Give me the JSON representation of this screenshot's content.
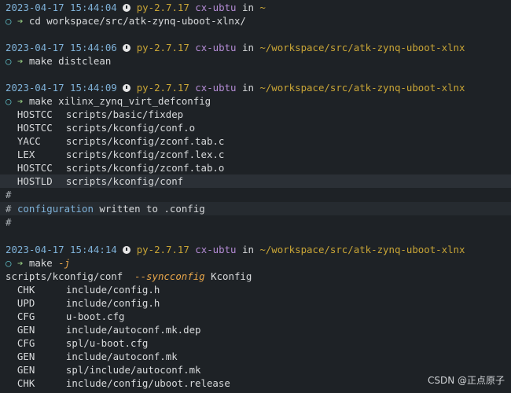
{
  "prompts": [
    {
      "date": "2023-04-17 15:44:04",
      "py": "py-2.7.17",
      "host": "cx-ubtu",
      "in": "in",
      "path": "~",
      "cmd": "cd workspace/src/atk-zynq-uboot-xlnx/"
    },
    {
      "date": "2023-04-17 15:44:06",
      "py": "py-2.7.17",
      "host": "cx-ubtu",
      "in": "in",
      "path": "~/workspace/src/atk-zynq-uboot-xlnx",
      "cmd": "make distclean"
    },
    {
      "date": "2023-04-17 15:44:09",
      "py": "py-2.7.17",
      "host": "cx-ubtu",
      "in": "in",
      "path": "~/workspace/src/atk-zynq-uboot-xlnx",
      "cmd": "make xilinx_zynq_virt_defconfig"
    },
    {
      "date": "2023-04-17 15:44:14",
      "py": "py-2.7.17",
      "host": "cx-ubtu",
      "in": "in",
      "path": "~/workspace/src/atk-zynq-uboot-xlnx",
      "cmd": "make",
      "flag": "-j"
    }
  ],
  "prompt_symbols": {
    "circle": "○",
    "arrow": "➔"
  },
  "defconfig_output": [
    {
      "tag": "HOSTCC",
      "file": "scripts/basic/fixdep"
    },
    {
      "tag": "HOSTCC",
      "file": "scripts/kconfig/conf.o"
    },
    {
      "tag": "YACC",
      "file": "scripts/kconfig/zconf.tab.c"
    },
    {
      "tag": "LEX",
      "file": "scripts/kconfig/zconf.lex.c"
    },
    {
      "tag": "HOSTCC",
      "file": "scripts/kconfig/zconf.tab.o"
    },
    {
      "tag": "HOSTLD",
      "file": "scripts/kconfig/conf"
    }
  ],
  "config_msg": {
    "hash": "#",
    "word": "configuration",
    "rest": " written to .config"
  },
  "make_output_head": {
    "cmd": "scripts/kconfig/conf",
    "flag": "--syncconfig",
    "arg": "Kconfig"
  },
  "make_output": [
    {
      "tag": "CHK",
      "file": "include/config.h"
    },
    {
      "tag": "UPD",
      "file": "include/config.h"
    },
    {
      "tag": "CFG",
      "file": "u-boot.cfg"
    },
    {
      "tag": "GEN",
      "file": "include/autoconf.mk.dep"
    },
    {
      "tag": "CFG",
      "file": "spl/u-boot.cfg"
    },
    {
      "tag": "GEN",
      "file": "include/autoconf.mk"
    },
    {
      "tag": "GEN",
      "file": "spl/include/autoconf.mk"
    },
    {
      "tag": "CHK",
      "file": "include/config/uboot.release"
    }
  ],
  "watermark": "CSDN @正点原子"
}
